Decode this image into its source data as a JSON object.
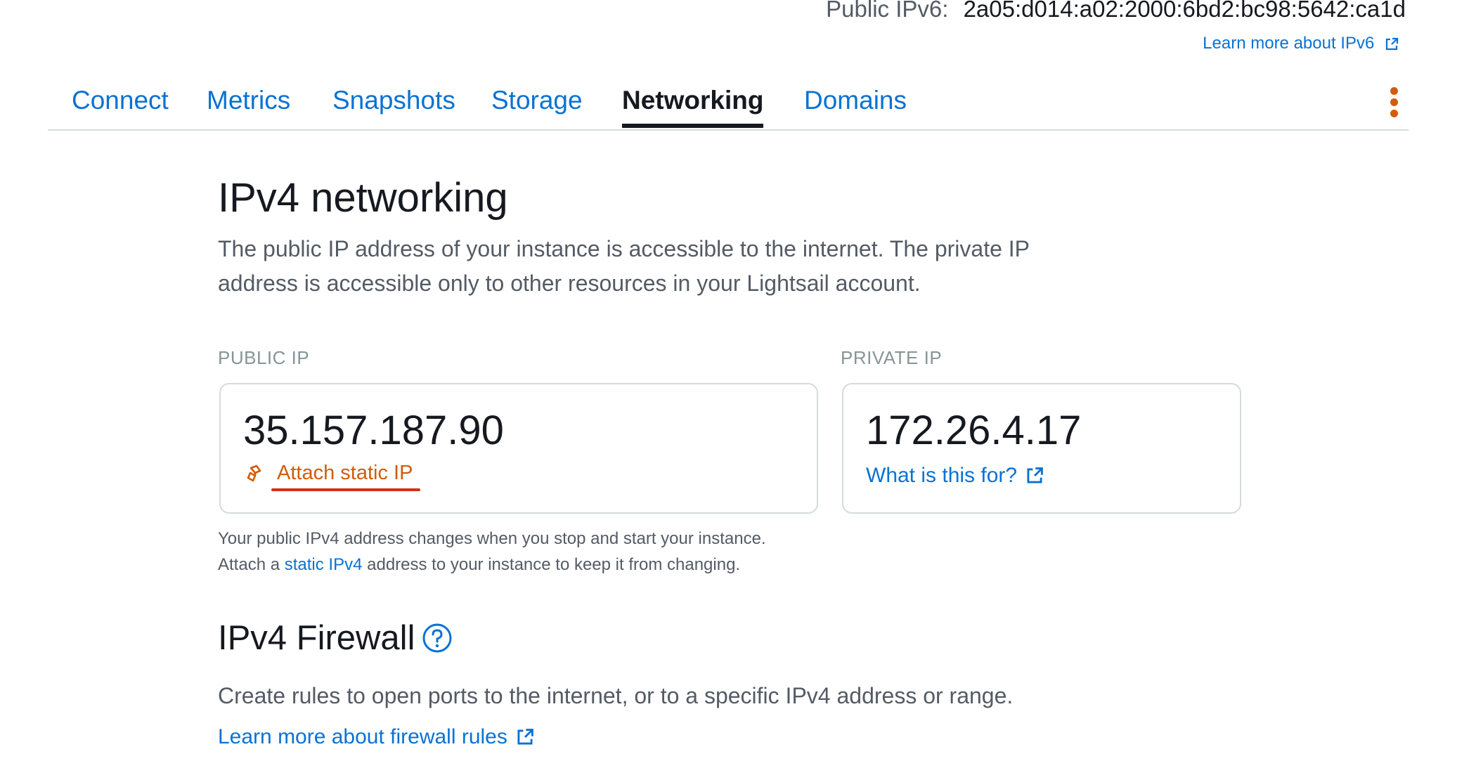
{
  "header": {
    "ipv6_label": "Public IPv6:",
    "ipv6_value": "2a05:d014:a02:2000:6bd2:bc98:5642:ca1d",
    "learn_ipv6": "Learn more about IPv6"
  },
  "tabs": [
    {
      "label": "Connect",
      "active": false
    },
    {
      "label": "Metrics",
      "active": false
    },
    {
      "label": "Snapshots",
      "active": false
    },
    {
      "label": "Storage",
      "active": false
    },
    {
      "label": "Networking",
      "active": true
    },
    {
      "label": "Domains",
      "active": false
    }
  ],
  "ipv4": {
    "title": "IPv4 networking",
    "description": "The public IP address of your instance is accessible to the internet. The private IP address is accessible only to other resources in your Lightsail account.",
    "public": {
      "label": "PUBLIC IP",
      "value": "35.157.187.90",
      "attach_label": "Attach static IP"
    },
    "private": {
      "label": "PRIVATE IP",
      "value": "172.26.4.17",
      "what_label": "What is this for?"
    },
    "note_line1": "Your public IPv4 address changes when you stop and start your instance.",
    "note_prefix": "Attach a",
    "note_link": "static IPv4",
    "note_suffix": "address to your instance to keep it from changing."
  },
  "firewall": {
    "title": "IPv4 Firewall",
    "description": "Create rules to open ports to the internet, or to a specific IPv4 address or range.",
    "learn_label": "Learn more about firewall rules"
  },
  "colors": {
    "link": "#0972d3",
    "accent_orange": "#d45b07",
    "underline_red": "#d13212",
    "text": "#16191f",
    "muted": "#545b64"
  },
  "icons": {
    "external": "external-link-icon",
    "static_ip": "static-ip-icon",
    "help": "help-icon",
    "more": "kebab-menu-icon"
  }
}
